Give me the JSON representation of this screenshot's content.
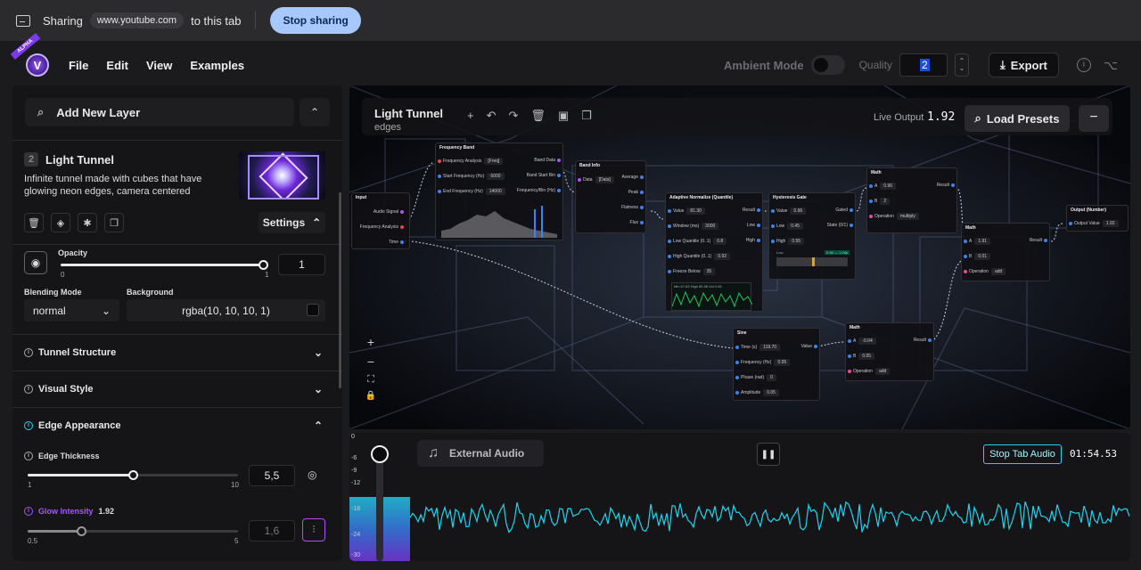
{
  "share": {
    "sharing_label": "Sharing",
    "url": "www.youtube.com",
    "to_tab": "to this tab",
    "stop": "Stop sharing"
  },
  "app": {
    "alpha": "ALPHA",
    "logo": "V"
  },
  "menu": [
    "File",
    "Edit",
    "View",
    "Examples"
  ],
  "toolbar": {
    "ambient": "Ambient Mode",
    "quality_label": "Quality",
    "quality_value": "2",
    "export": "Export",
    "up": "⌃",
    "down": "⌄"
  },
  "left": {
    "add_layer": "Add New Layer",
    "layer_num": "2",
    "layer_title": "Light Tunnel",
    "layer_desc": "Infinite tunnel made with cubes that have glowing neon edges, camera centered",
    "settings": "Settings",
    "opacity_label": "Opacity",
    "opacity_min": "0",
    "opacity_max": "1",
    "opacity_value": "1",
    "opacity_fraction": 1.0,
    "blend_label": "Blending Mode",
    "blend_value": "normal",
    "bg_label": "Background",
    "bg_value": "rgba(10, 10, 10, 1)",
    "sections": [
      {
        "title": "Tunnel Structure"
      },
      {
        "title": "Visual Style"
      },
      {
        "title": "Edge Appearance"
      }
    ],
    "edge_thickness_label": "Edge Thickness",
    "edge_min": "1",
    "edge_max": "10",
    "edge_value": "5,5",
    "glow_label": "Glow Intensity",
    "glow_live": "1.92",
    "glow_min": "0.5",
    "glow_max": "5",
    "glow_value": "1,6"
  },
  "canvas": {
    "title": "Light Tunnel",
    "subtitle": "edges",
    "live_label": "Live Output",
    "live_value": "1.92",
    "load_presets": "Load Presets",
    "nodes": {
      "input": {
        "title": "Input",
        "rows": [
          "Audio Signal",
          "Frequency Analysis",
          "Time"
        ]
      },
      "freqband": {
        "title": "Frequency Band",
        "rows": [
          "Frequency Analysis",
          "Start Frequency (Hz)",
          "End Frequency (Hz)"
        ],
        "vals": [
          "[Freq]",
          "6000",
          "14000"
        ],
        "outs": [
          "Band Data",
          "Band Start Bin",
          "Frequency/Bin (Hz)"
        ]
      },
      "bandinfo": {
        "title": "Band Info",
        "rows": [
          "Data",
          "Average",
          "Peak",
          "Flatness",
          "Flux"
        ],
        "vals": [
          "[Data]"
        ]
      },
      "adaptive": {
        "title": "Adaptive Normalize (Quantile)",
        "rows": [
          "Value",
          "Window (ms)",
          "Low Quantile (0..1)",
          "High Quantile (0..1)",
          "Freeze Below"
        ],
        "vals": [
          "81.30",
          "3000",
          "0.8",
          "0.92",
          "35"
        ],
        "outs": [
          "Result",
          "Low",
          "High"
        ],
        "overlay": "Min 67.63 High 85.96 Vol 0.06"
      },
      "hysteresis": {
        "title": "Hysteresis Gate",
        "rows": [
          "Value",
          "Low",
          "High"
        ],
        "vals": [
          "0.96",
          "0.45",
          "0.55"
        ],
        "outs": [
          "Gated",
          "State (0/1)"
        ],
        "low_label": "Low",
        "badge": "0.96 — 1.0dp"
      },
      "math1": {
        "title": "Math",
        "rows": [
          "A",
          "B",
          "Operation"
        ],
        "vals": [
          "0.96",
          "2",
          "multiply"
        ],
        "outs": [
          "Result"
        ]
      },
      "math2": {
        "title": "Math",
        "rows": [
          "A",
          "B",
          "Operation"
        ],
        "vals": [
          "1.91",
          "0.01",
          "add"
        ],
        "outs": [
          "Result"
        ]
      },
      "output": {
        "title": "Output (Number)",
        "rows": [
          "Output Value"
        ],
        "vals": [
          "1.92"
        ]
      },
      "sine": {
        "title": "Sine",
        "rows": [
          "Time (s)",
          "Frequency (Hz)",
          "Phase (rad)",
          "Amplitude"
        ],
        "vals": [
          "119.70",
          "0.05",
          "0",
          "0.05"
        ],
        "outs": [
          "Value"
        ]
      },
      "math3": {
        "title": "Math",
        "rows": [
          "A",
          "B",
          "Operation"
        ],
        "vals": [
          "-0.04",
          "0.05",
          "add"
        ],
        "outs": [
          "Result"
        ]
      }
    },
    "zoom": {
      "plus": "+",
      "minus": "−",
      "fit": "⛶",
      "lock": "🔒"
    }
  },
  "audio": {
    "scale": [
      "0",
      "-6",
      "-9",
      "-12",
      "-18",
      "-24",
      "-30"
    ],
    "source": "External Audio",
    "stop": "Stop Tab Audio",
    "time": "01:54.53",
    "level_fraction": 0.5
  },
  "colors": {
    "accent": "#a8c7fa",
    "cyan": "#22d3ee",
    "purple": "#a855f7"
  }
}
